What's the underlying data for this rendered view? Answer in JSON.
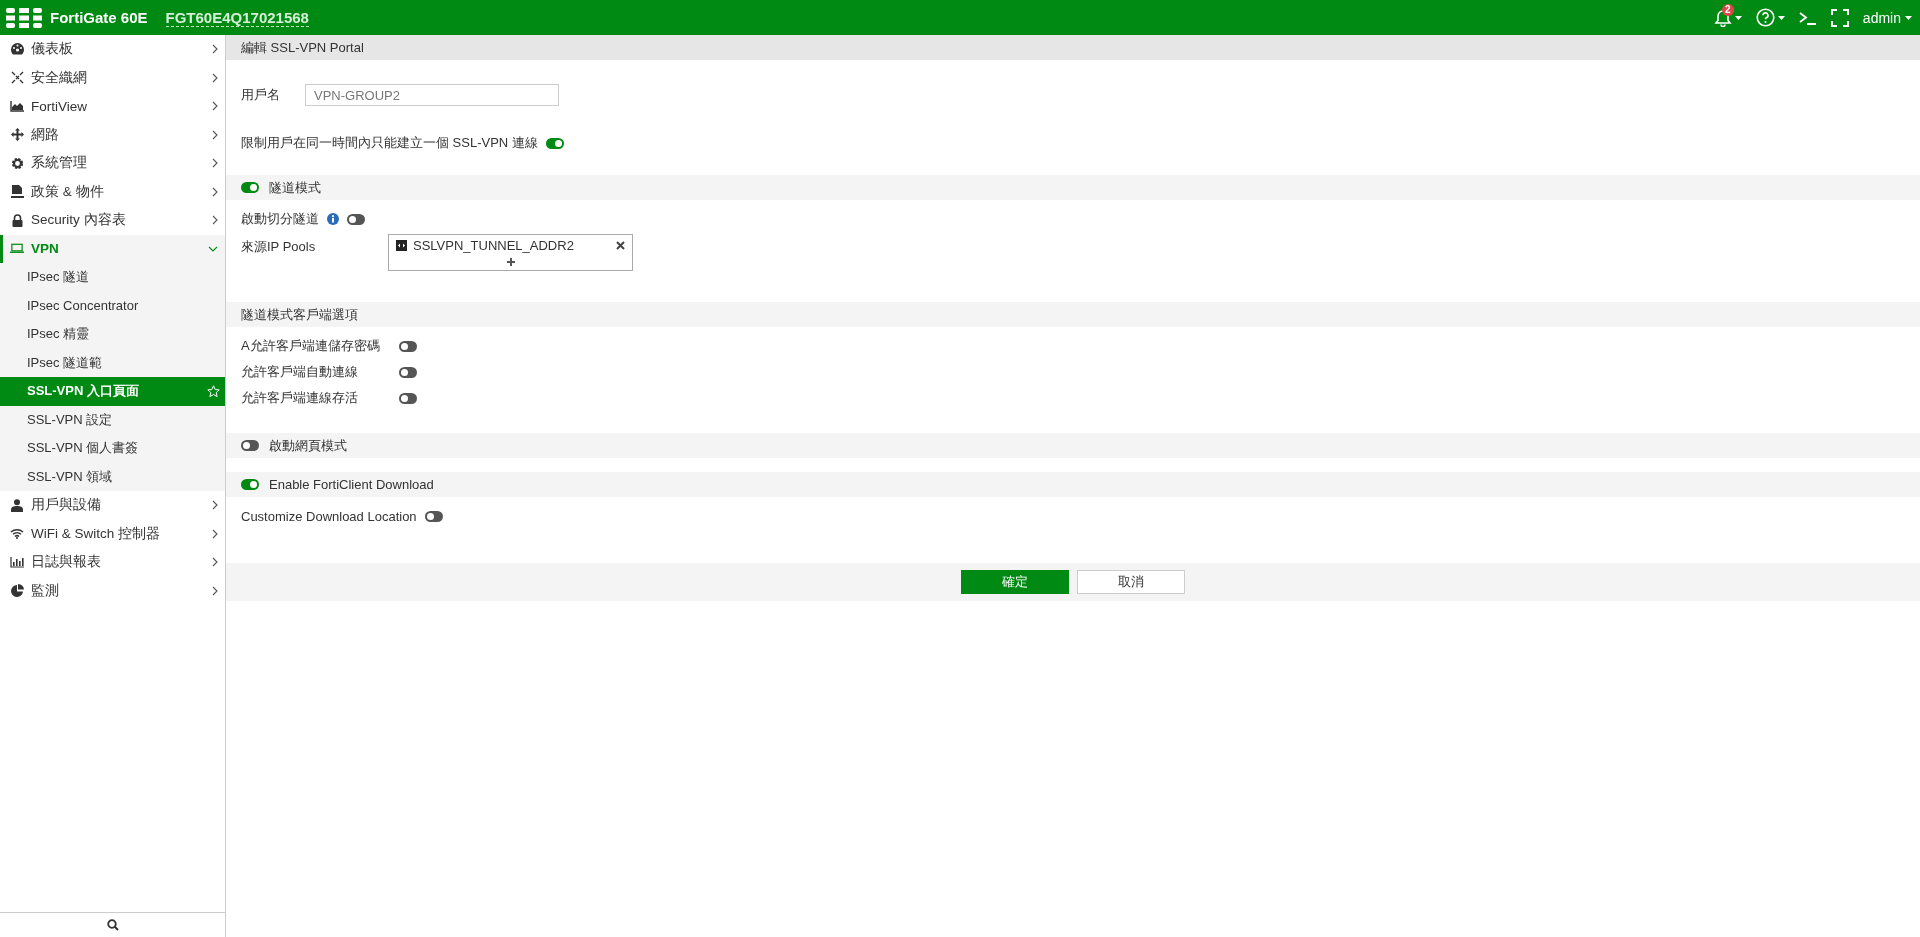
{
  "header": {
    "model": "FortiGate 60E",
    "serial": "FGT60E4Q17021568",
    "notification_count": "2",
    "user": "admin"
  },
  "sidebar": {
    "items": [
      {
        "label": "儀表板",
        "expanded": false,
        "selected": false
      },
      {
        "label": "安全織網",
        "expanded": false,
        "selected": false
      },
      {
        "label": "FortiView",
        "expanded": false,
        "selected": false
      },
      {
        "label": "網路",
        "expanded": false,
        "selected": false
      },
      {
        "label": "系統管理",
        "expanded": false,
        "selected": false
      },
      {
        "label": "政策 & 物件",
        "expanded": false,
        "selected": false
      },
      {
        "label": "Security 內容表",
        "expanded": false,
        "selected": false
      },
      {
        "label": "VPN",
        "expanded": true,
        "selected": true,
        "children": [
          {
            "label": "IPsec 隧道",
            "selected": false
          },
          {
            "label": "IPsec Concentrator",
            "selected": false
          },
          {
            "label": "IPsec 精靈",
            "selected": false
          },
          {
            "label": "IPsec 隧道範",
            "selected": false
          },
          {
            "label": "SSL-VPN 入口頁面",
            "selected": true
          },
          {
            "label": "SSL-VPN 設定",
            "selected": false
          },
          {
            "label": "SSL-VPN 個人書簽",
            "selected": false
          },
          {
            "label": "SSL-VPN 領域",
            "selected": false
          }
        ]
      },
      {
        "label": "用戶與設備",
        "expanded": false,
        "selected": false
      },
      {
        "label": "WiFi & Switch 控制器",
        "expanded": false,
        "selected": false
      },
      {
        "label": "日誌與報表",
        "expanded": false,
        "selected": false
      },
      {
        "label": "監測",
        "expanded": false,
        "selected": false
      }
    ]
  },
  "form": {
    "title": "編輯 SSL-VPN Portal",
    "blocks": [
      {
        "kind": "field",
        "label": "用戶名",
        "value": "VPN-GROUP2"
      },
      {
        "kind": "toggle",
        "label": "限制用戶在同一時間內只能建立一個 SSL-VPN 連線",
        "on": true
      },
      {
        "kind": "section",
        "label": "隧道模式",
        "on": true
      },
      {
        "kind": "toggle",
        "label": "啟動切分隧道",
        "on": false,
        "info": true
      },
      {
        "kind": "pools",
        "label": "來源IP Pools",
        "items": [
          "SSLVPN_TUNNEL_ADDR2"
        ]
      },
      {
        "kind": "heading",
        "label": "隧道模式客戶端選項"
      },
      {
        "kind": "option",
        "label": "A允許客戶端連儲存密碼",
        "on": false
      },
      {
        "kind": "option",
        "label": "允許客戶端自動連線",
        "on": false
      },
      {
        "kind": "option",
        "label": "允許客戶端連線存活",
        "on": false
      },
      {
        "kind": "section",
        "label": "啟動網頁模式",
        "on": false
      },
      {
        "kind": "section",
        "label": "Enable FortiClient Download",
        "on": true
      },
      {
        "kind": "toggle",
        "label": "Customize Download Location",
        "on": false
      }
    ],
    "buttons": [
      {
        "label": "確定",
        "kind": "primary"
      },
      {
        "label": "取消",
        "kind": "secondary"
      }
    ]
  }
}
